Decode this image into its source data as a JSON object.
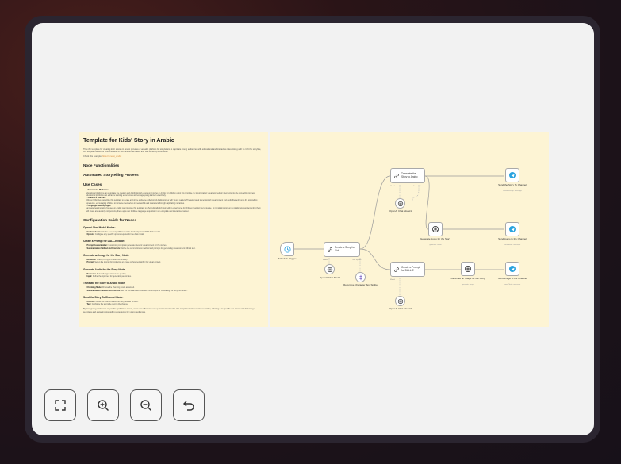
{
  "note_left": {
    "title": "Template for Kids' Story in Arabic",
    "intro": "This n8n template for creating kids' stories in Arabic provides a versatile platform for storytellers to captivate young audiences with educational and interactive tales. Along with to craft the storyline, this template allows for customization to suit various use cases and can be set up effortlessly.",
    "example_prefix": "Check this example: ",
    "example_link": "https://t.me/st_arabic",
    "h_node_functionalities": "Node Functionalities",
    "h_automated": "Automated Storytelling Process",
    "h_use_cases": "Use Cases",
    "use_cases": [
      {
        "title": "Educational Platforms:",
        "text": "Educational platforms can automate the creation and distribution of educational stories in Arabic for children using this template. By incorporating visual and auditory elements into the storytelling process, educational platforms can enhance learning experiences and engage young learners effectively."
      },
      {
        "title": "Children's Libraries:",
        "text": "Children's libraries can utilize this template to curate and share a diverse collection of Arabic stories with young readers. The automated generation of visual content and audio files enhances the storytelling experience, encouraging children to immerse themselves in new worlds and characters through captivating narratives."
      },
      {
        "title": "Language Learning Apps:",
        "text": "Language learning apps focused on Arabic can integrate this template to offer culturally rich storytelling experiences for children learning the language. By translating stories into Arabic and supplementing them with visual and auditory components, these apps can facilitate language acquisition in an enjoyable and interactive manner."
      }
    ],
    "h_config": "Configuration Guide for Nodes",
    "config": [
      {
        "title": "Openai Chat Model Nodes:",
        "items": [
          {
            "k": "Credentials:",
            "v": "Provide the necessary API credentials for the OpenAI GPT-4 Turbo model."
          },
          {
            "k": "Options:",
            "v": "Configure any specific options required for the chat model."
          }
        ]
      },
      {
        "title": "Create a Prompt for DALL-E Node:",
        "items": [
          {
            "k": "Prompt Customization:",
            "v": "Customize prompts to generate relevant visual content for the stories."
          },
          {
            "k": "Summarization Method and Prompts:",
            "v": "Define the summarization method and prompts for generating visual content without text."
          }
        ]
      },
      {
        "title": "Generate an Image for the Story Node:",
        "items": [
          {
            "k": "Resource:",
            "v": "Specify the type of resource (image)."
          },
          {
            "k": "Prompt:",
            "v": "Set up the prompt for producing an image without text within the visual content."
          }
        ]
      },
      {
        "title": "Generate Audio for the Story Node:",
        "items": [
          {
            "k": "Resource:",
            "v": "Select the type of resource (audio)."
          },
          {
            "k": "Input:",
            "v": "Define the input text for generating audio files."
          }
        ]
      },
      {
        "title": "Translate the Story to Arabic Node:",
        "items": [
          {
            "k": "Chunking Mode:",
            "v": "Choose the chunking mode advanced."
          },
          {
            "k": "Summarization Method and Prompts:",
            "v": "Set the summarization method and prompts for translating the story into Arabic."
          }
        ]
      },
      {
        "title": "Send the Story To Channel Node:",
        "items": [
          {
            "k": "Chat ID:",
            "v": "Provide the chat ID where the story text will be sent."
          },
          {
            "k": "Text:",
            "v": "Configure the text to be sent to the channel."
          }
        ]
      }
    ],
    "outro": "By configuring each node as per the guidelines above, users can effectively set up and customize the n8n template for kids' stories in Arabic, tailoring it to specific use cases and delivering a seamless and engaging storytelling experience for young audiences."
  },
  "workflow": {
    "schedule_trigger": "Schedule Trigger",
    "create_story": "Create a Story for Kids",
    "openai_model_1": "OpenAI Chat Model",
    "splitter": "Recursive Character Text Splitter",
    "translate": "Translate the Story to Arabic",
    "openai_model_2": "OpenAI Chat Model1",
    "audio": "Generate Audio for the Story",
    "audio_sub": "generate: audio",
    "send_story": "Send the Story To Channel",
    "send_story_sub": "sendMessage: message",
    "send_audio": "Send Audio to the Channel",
    "send_audio_sub": "sendAudio: message",
    "prompt_dalle": "Create a Prompt for DALL-E",
    "openai_model_3": "OpenAI Chat Model2",
    "image": "Generate an Image for the Story",
    "image_sub": "generate: image",
    "send_image": "Send Image to the Channel",
    "send_image_sub": "sendPhoto: message",
    "tag_model": "Model",
    "tag_splitter": "Text Splitter",
    "tag_doc": "Document"
  },
  "controls": {
    "fit": "fit-view",
    "zoom_in": "zoom-in",
    "zoom_out": "zoom-out",
    "undo": "undo"
  }
}
